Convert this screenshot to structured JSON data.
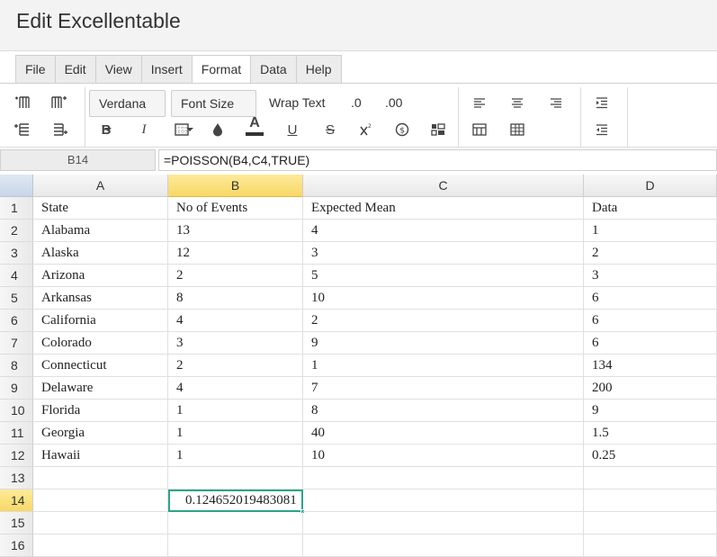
{
  "app": {
    "title": "Edit Excellentable"
  },
  "menu": {
    "items": [
      "File",
      "Edit",
      "View",
      "Insert",
      "Format",
      "Data",
      "Help"
    ],
    "active_index": 4
  },
  "toolbar": {
    "font_family": "Verdana",
    "font_size": "Font Size",
    "wrap_text": "Wrap Text",
    "decrease_decimal": ".0",
    "increase_decimal": ".00",
    "bold": "B",
    "italic": "I",
    "underline": "U",
    "strike": "S",
    "text_color_glyph": "A",
    "text_color": "#333333"
  },
  "formula_bar": {
    "cell_ref": "B14",
    "formula": "=POISSON(B4,C4,TRUE)"
  },
  "sheet": {
    "columns": [
      "A",
      "B",
      "C",
      "D"
    ],
    "selected_column": "B",
    "selected_row": "14",
    "rows": [
      {
        "n": "1",
        "cells": [
          "State",
          "No of Events",
          "Expected Mean",
          "Data"
        ]
      },
      {
        "n": "2",
        "cells": [
          "Alabama",
          "13",
          "4",
          "1"
        ]
      },
      {
        "n": "3",
        "cells": [
          "Alaska",
          "12",
          "3",
          "2"
        ]
      },
      {
        "n": "4",
        "cells": [
          "Arizona",
          "2",
          "5",
          "3"
        ]
      },
      {
        "n": "5",
        "cells": [
          "Arkansas",
          "8",
          "10",
          "6"
        ]
      },
      {
        "n": "6",
        "cells": [
          "California",
          "4",
          "2",
          "6"
        ]
      },
      {
        "n": "7",
        "cells": [
          "Colorado",
          "3",
          "9",
          "6"
        ]
      },
      {
        "n": "8",
        "cells": [
          "Connecticut",
          "2",
          "1",
          "134"
        ]
      },
      {
        "n": "9",
        "cells": [
          "Delaware",
          "4",
          "7",
          "200"
        ]
      },
      {
        "n": "10",
        "cells": [
          "Florida",
          "1",
          "8",
          "9"
        ]
      },
      {
        "n": "11",
        "cells": [
          "Georgia",
          "1",
          "40",
          "1.5"
        ]
      },
      {
        "n": "12",
        "cells": [
          "Hawaii",
          "1",
          "10",
          "0.25"
        ]
      },
      {
        "n": "13",
        "cells": [
          "",
          "",
          "",
          ""
        ]
      },
      {
        "n": "14",
        "cells": [
          "",
          "0.124652019483081",
          "",
          ""
        ]
      },
      {
        "n": "15",
        "cells": [
          "",
          "",
          "",
          ""
        ]
      },
      {
        "n": "16",
        "cells": [
          "",
          "",
          "",
          ""
        ]
      }
    ]
  },
  "colors": {
    "active_cell_border": "#2ba58a",
    "selected_header": "#f8d866"
  }
}
